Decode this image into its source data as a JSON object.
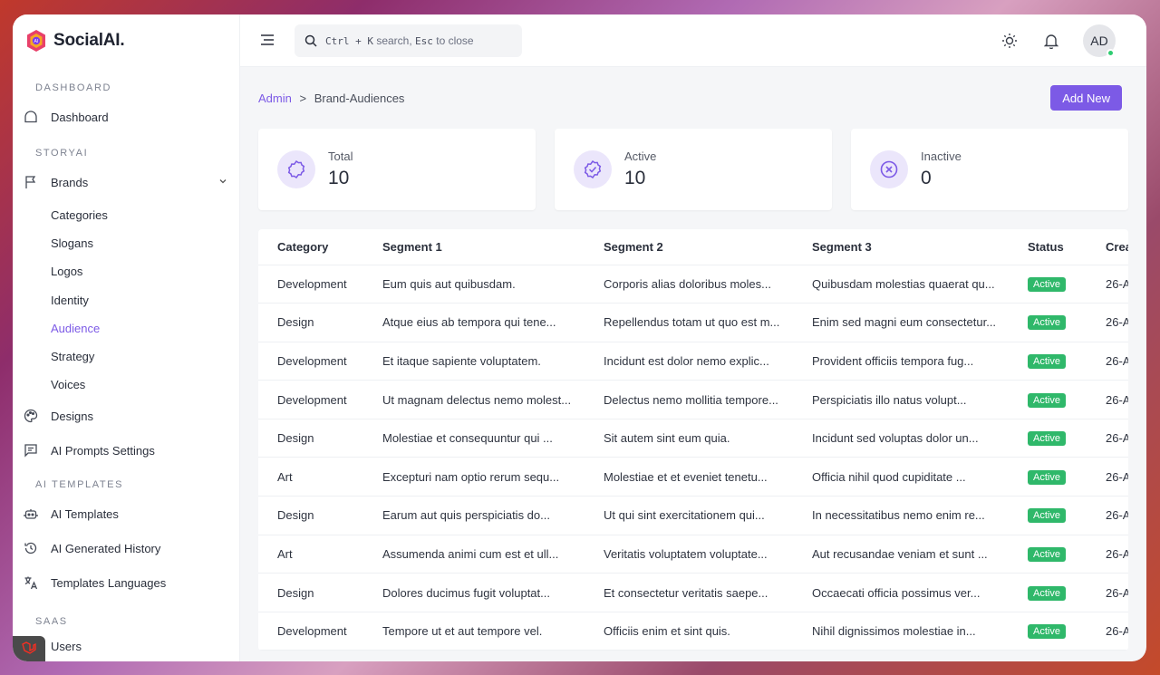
{
  "brand": {
    "name": "SocialAI."
  },
  "sidebar": {
    "sections": {
      "dashboard": "DASHBOARD",
      "storyai": "STORYAI",
      "ai_templates": "AI TEMPLATES",
      "saas": "SAAS"
    },
    "dashboard": "Dashboard",
    "brands": "Brands",
    "brand_subitems": [
      "Categories",
      "Slogans",
      "Logos",
      "Identity",
      "Audience",
      "Strategy",
      "Voices"
    ],
    "designs": "Designs",
    "ai_prompts": "AI Prompts Settings",
    "ai_templates": "AI Templates",
    "ai_history": "AI Generated History",
    "templates_languages": "Templates Languages",
    "users": "Users"
  },
  "topbar": {
    "search_k1": "Ctrl + K",
    "search_t1": "search,",
    "search_k2": "Esc",
    "search_t2": "to close",
    "avatar": "AD"
  },
  "breadcrumb": {
    "root": "Admin",
    "sep": ">",
    "current": "Brand-Audiences"
  },
  "add_new": "Add New",
  "stats": {
    "total_label": "Total",
    "total_value": "10",
    "active_label": "Active",
    "active_value": "10",
    "inactive_label": "Inactive",
    "inactive_value": "0"
  },
  "table": {
    "headers": [
      "Category",
      "Segment 1",
      "Segment 2",
      "Segment 3",
      "Status",
      "Crea"
    ],
    "rows": [
      [
        "Development",
        "Eum quis aut quibusdam.",
        "Corporis alias doloribus moles...",
        "Quibusdam molestias quaerat qu...",
        "Active",
        "26-A"
      ],
      [
        "Design",
        "Atque eius ab tempora qui tene...",
        "Repellendus totam ut quo est m...",
        "Enim sed magni eum consectetur...",
        "Active",
        "26-A"
      ],
      [
        "Development",
        "Et itaque sapiente voluptatem.",
        "Incidunt est dolor nemo explic...",
        "Provident officiis tempora fug...",
        "Active",
        "26-A"
      ],
      [
        "Development",
        "Ut magnam delectus nemo molest...",
        "Delectus nemo mollitia tempore...",
        "Perspiciatis illo natus volupt...",
        "Active",
        "26-A"
      ],
      [
        "Design",
        "Molestiae et consequuntur qui ...",
        "Sit autem sint eum quia.",
        "Incidunt sed voluptas dolor un...",
        "Active",
        "26-A"
      ],
      [
        "Art",
        "Excepturi nam optio rerum sequ...",
        "Molestiae et et eveniet tenetu...",
        "Officia nihil quod cupiditate ...",
        "Active",
        "26-A"
      ],
      [
        "Design",
        "Earum aut quis perspiciatis do...",
        "Ut qui sint exercitationem qui...",
        "In necessitatibus nemo enim re...",
        "Active",
        "26-A"
      ],
      [
        "Art",
        "Assumenda animi cum est et ull...",
        "Veritatis voluptatem voluptate...",
        "Aut recusandae veniam et sunt ...",
        "Active",
        "26-A"
      ],
      [
        "Design",
        "Dolores ducimus fugit voluptat...",
        "Et consectetur veritatis saepe...",
        "Occaecati officia possimus ver...",
        "Active",
        "26-A"
      ],
      [
        "Development",
        "Tempore ut et aut tempore vel.",
        "Officiis enim et sint quis.",
        "Nihil dignissimos molestiae in...",
        "Active",
        "26-A"
      ]
    ]
  },
  "colors": {
    "accent": "#7c5ae6",
    "active_badge": "#2fb86a",
    "online_dot": "#2ecc71"
  }
}
